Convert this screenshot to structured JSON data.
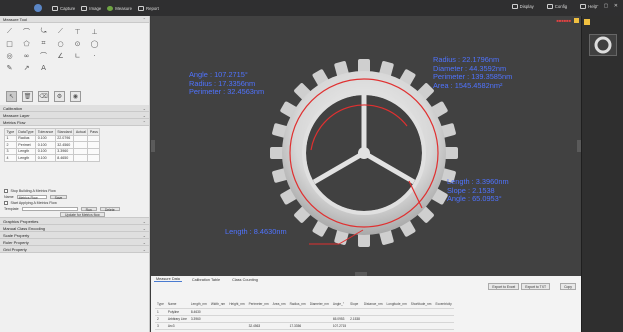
{
  "toolbar": {
    "capture": "Capture",
    "image": "Image",
    "measure": "Measure",
    "report": "Report",
    "display": "Display",
    "config": "Config",
    "help": "Help"
  },
  "left": {
    "measure_tool": "Measure Tool",
    "calibration": "Calibration",
    "measure_layer": "Measure Layer",
    "metrics_flow": "Metrics Flow",
    "flow_headers": [
      "Type",
      "DataType",
      "Tolerance",
      "Standard",
      "Actual",
      "Pass"
    ],
    "flow_rows": [
      [
        "1",
        "Radius",
        "0.100",
        "22.0796",
        "",
        ""
      ],
      [
        "2",
        "Perimet",
        "0.100",
        "32.4560",
        "",
        ""
      ],
      [
        "3",
        "Length",
        "0.100",
        "3.3960",
        "",
        ""
      ],
      [
        "4",
        "Length",
        "0.100",
        "8.4650",
        "",
        ""
      ]
    ],
    "stop_building": "Stop Building A Metrics Flow",
    "name_label": "Name",
    "name_value": "Metrics Flow",
    "save": "Save",
    "start_applying": "Start Applying A Metrics Flow",
    "template_label": "Template",
    "run": "Run",
    "delete": "Delete",
    "update": "Update for Metrics flow",
    "graphics_properties": "Graphics Properties",
    "manual_class_encoding": "Manual Class Encoding",
    "scale_property": "Scale Property",
    "ruler_property": "Ruler Property",
    "grid_property": "Grid Property"
  },
  "annotations": {
    "left_angle": "Angle : 107.2715°",
    "left_radius": "Radius : 17.3356nm",
    "left_perimeter": "Perimeter : 32.4563nm",
    "right_radius": "Radius : 22.1796nm",
    "right_diameter": "Diameter : 44.3592nm",
    "right_perimeter": "Perimeter : 139.3585nm",
    "right_area": "Area : 1545.4582nm²",
    "br_length": "Length : 3.3960nm",
    "br_slope": "Slope : 2.1538",
    "br_angle": "Angle : 65.0953°",
    "bottom_length": "Length : 8.4630nm"
  },
  "bottom": {
    "tabs": [
      "Measure Data",
      "Calibration Table",
      "Class Counting"
    ],
    "export_excel": "Export to Excel",
    "export_txt": "Export to TXT",
    "copy": "Copy",
    "headers": [
      "Type",
      "Name",
      "Length_nm",
      "Width_nm",
      "Height_nm",
      "Perimeter_nm",
      "Area_nm",
      "Radius_nm",
      "Diameter_nm",
      "Angle_°",
      "Slope",
      "Distance_nm",
      "Longitude_nm",
      "Shortitude_nm",
      "Eccentricity"
    ],
    "rows": [
      [
        "1",
        "Polyline",
        "8.4630",
        "",
        "",
        "",
        "",
        "",
        "",
        "",
        "",
        "",
        "",
        "",
        ""
      ],
      [
        "2",
        "Arbitrary Line",
        "3.3960",
        "",
        "",
        "",
        "",
        "",
        "",
        "65.0953",
        "2.1538",
        "",
        "",
        "",
        ""
      ],
      [
        "3",
        "Arc3",
        "",
        "",
        "",
        "32.4563",
        "",
        "17.3356",
        "",
        "107.2715",
        "",
        "",
        "",
        "",
        ""
      ]
    ]
  },
  "colors": {
    "annotation": "#4f73ff",
    "circle": "#e03030",
    "accent": "#6fa543"
  }
}
